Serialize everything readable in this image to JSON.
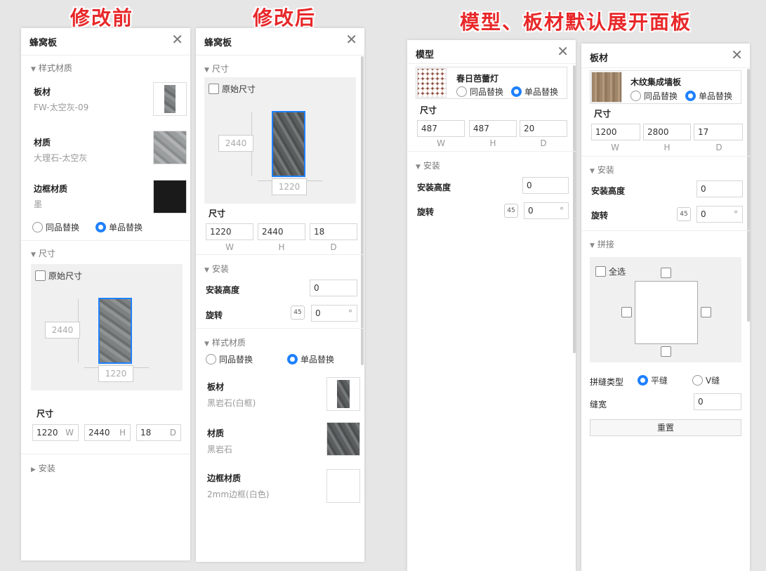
{
  "headings": {
    "before": "修改前",
    "after": "修改后",
    "default_expanded": "模型、板材默认展开面板"
  },
  "colors": {
    "accent": "#1e80ff",
    "heading_red": "#e8282a"
  },
  "panel1": {
    "title": "蜂窝板",
    "close": "✕",
    "style_section": "样式材质",
    "items": [
      {
        "label": "板材",
        "value": "FW-太空灰-09"
      },
      {
        "label": "材质",
        "value": "大理石-太空灰"
      },
      {
        "label": "边框材质",
        "value": "墨"
      }
    ],
    "radio_same": "同品替换",
    "radio_single": "单品替换",
    "size_section": "尺寸",
    "original_size": "原始尺寸",
    "height_dim": "2440",
    "width_dim": "1220",
    "size_label": "尺寸",
    "w": "1220",
    "w_unit": "W",
    "h": "2440",
    "h_unit": "H",
    "d": "18",
    "d_unit": "D",
    "install_section": "安装"
  },
  "panel2": {
    "title": "蜂窝板",
    "close": "✕",
    "size_section": "尺寸",
    "original_size": "原始尺寸",
    "height_dim": "2440",
    "width_dim": "1220",
    "size_label": "尺寸",
    "w": "1220",
    "h": "2440",
    "d": "18",
    "w_axis": "W",
    "h_axis": "H",
    "d_axis": "D",
    "install_section": "安装",
    "install_height_label": "安装高度",
    "install_height": "0",
    "rotate_label": "旋转",
    "rotate_icon": "45",
    "rotate": "0",
    "rotate_unit": "°",
    "style_section": "样式材质",
    "radio_same": "同品替换",
    "radio_single": "单品替换",
    "items": [
      {
        "label": "板材",
        "value": "黑岩石(白框)"
      },
      {
        "label": "材质",
        "value": "黑岩石"
      },
      {
        "label": "边框材质",
        "value": "2mm边框(白色)"
      }
    ]
  },
  "panel3": {
    "title": "模型",
    "close": "✕",
    "model_name": "春日芭蕾灯",
    "radio_same": "同品替换",
    "radio_single": "单品替换",
    "size_label": "尺寸",
    "w": "487",
    "h": "487",
    "d": "20",
    "w_axis": "W",
    "h_axis": "H",
    "d_axis": "D",
    "install_section": "安装",
    "install_height_label": "安装高度",
    "install_height": "0",
    "rotate_label": "旋转",
    "rotate_icon": "45",
    "rotate": "0",
    "rotate_unit": "°"
  },
  "panel4": {
    "title": "板材",
    "close": "✕",
    "model_name": "木纹集成墙板",
    "radio_same": "同品替换",
    "radio_single": "单品替换",
    "size_label": "尺寸",
    "w": "1200",
    "h": "2800",
    "d": "17",
    "w_axis": "W",
    "h_axis": "H",
    "d_axis": "D",
    "install_section": "安装",
    "install_height_label": "安装高度",
    "install_height": "0",
    "rotate_label": "旋转",
    "rotate_icon": "45",
    "rotate": "0",
    "rotate_unit": "°",
    "splice_section": "拼接",
    "select_all": "全选",
    "seam_type_label": "拼缝类型",
    "seam_flat": "平缝",
    "seam_v": "V缝",
    "seam_width_label": "缝宽",
    "seam_width": "0",
    "reset": "重置"
  }
}
